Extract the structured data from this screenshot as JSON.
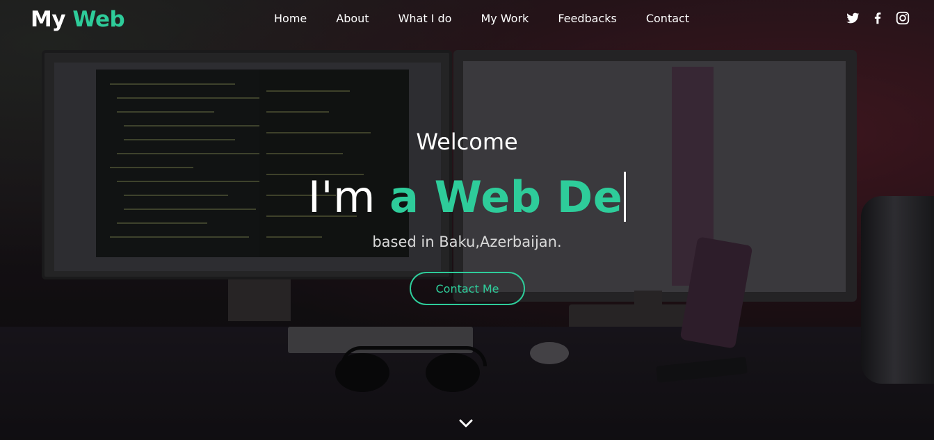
{
  "brand": {
    "logo_main": "My",
    "logo_accent": "Web",
    "accent_color": "#2ecc9a"
  },
  "nav": {
    "links": [
      {
        "label": "Home"
      },
      {
        "label": "About"
      },
      {
        "label": "What I do"
      },
      {
        "label": "My Work"
      },
      {
        "label": "Feedbacks"
      },
      {
        "label": "Contact"
      }
    ],
    "socials": [
      {
        "icon": "twitter-icon"
      },
      {
        "icon": "facebook-icon"
      },
      {
        "icon": "instagram-icon"
      }
    ]
  },
  "hero": {
    "welcome": "Welcome",
    "headline_prefix": "I'm ",
    "headline_typed": "a Web De",
    "subtitle": "based in Baku,Azerbaijan.",
    "cta_label": "Contact Me",
    "scroll_icon": "chevron-down-icon"
  }
}
